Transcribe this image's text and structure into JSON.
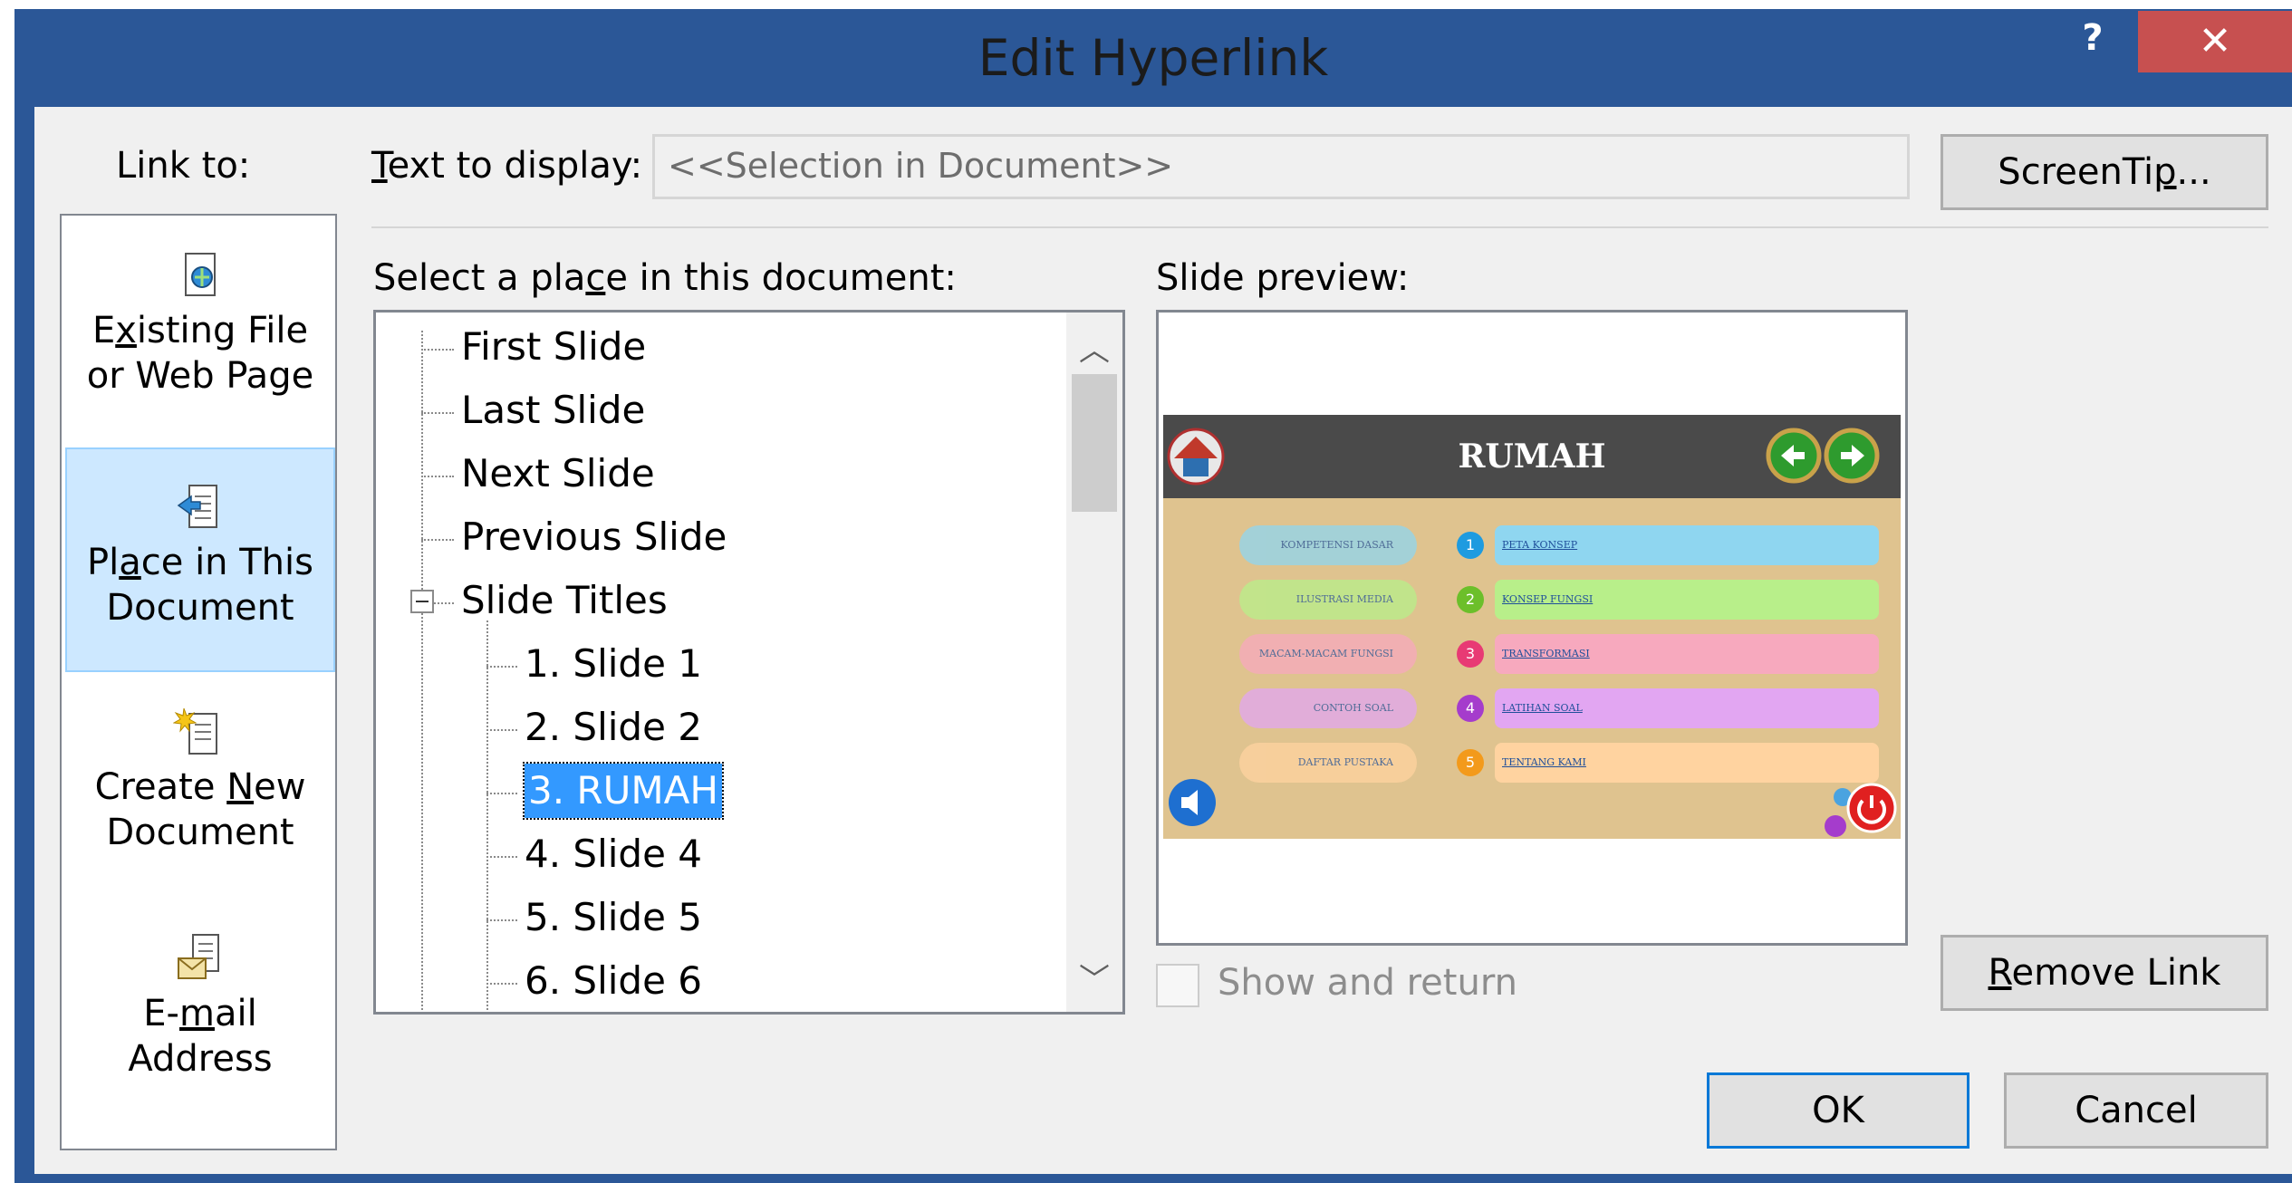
{
  "window": {
    "title": "Edit Hyperlink",
    "help_label": "?",
    "close_label": "✕"
  },
  "link_to": {
    "label": "Link to:",
    "items": [
      {
        "line1_pre": "E",
        "line1_u": "x",
        "line1_post": "isting File",
        "line2": "or Web Page",
        "icon": "existing-file-icon",
        "selected": false
      },
      {
        "line1_pre": "Pl",
        "line1_u": "a",
        "line1_post": "ce in This",
        "line2": "Document",
        "icon": "place-in-document-icon",
        "selected": true
      },
      {
        "line1_pre": "Create ",
        "line1_u": "N",
        "line1_post": "ew",
        "line2": "Document",
        "icon": "create-new-document-icon",
        "selected": false
      },
      {
        "line1_pre": "E-",
        "line1_u": "m",
        "line1_post": "ail",
        "line2": "Address",
        "icon": "email-address-icon",
        "selected": false
      }
    ]
  },
  "text_to_display": {
    "label_u": "T",
    "label_rest": "ext to display:",
    "value": "<<Selection in Document>>"
  },
  "buttons": {
    "screentip_pre": "ScreenTi",
    "screentip_u": "p",
    "screentip_post": "...",
    "remove_u": "R",
    "remove_rest": "emove Link",
    "ok": "OK",
    "cancel": "Cancel"
  },
  "place": {
    "label_pre": "Select a pla",
    "label_u": "c",
    "label_post": "e in this document:",
    "items": [
      "First Slide",
      "Last Slide",
      "Next Slide",
      "Previous Slide",
      "Slide Titles",
      "1. Slide 1",
      "2. Slide 2",
      "3. RUMAH",
      "4. Slide 4",
      "5. Slide 5",
      "6. Slide 6"
    ],
    "selected_index": 7
  },
  "preview": {
    "label": "Slide preview:",
    "slide_title": "RUMAH",
    "rows": [
      {
        "left": "KOMPETENSI DASAR",
        "num": "1",
        "right": "PETA KONSEP",
        "color": "#8fd6f0",
        "num_color": "#1e9be0"
      },
      {
        "left": "ILUSTRASI MEDIA",
        "num": "2",
        "right": "KONSEP FUNGSI",
        "color": "#b8ef8a",
        "num_color": "#6cbf2a"
      },
      {
        "left": "MACAM-MACAM FUNGSI",
        "num": "3",
        "right": "TRANSFORMASI",
        "color": "#f7a9be",
        "num_color": "#e83a74"
      },
      {
        "left": "CONTOH SOAL",
        "num": "4",
        "right": "LATIHAN SOAL",
        "color": "#e2a6f2",
        "num_color": "#a53ccc"
      },
      {
        "left": "DAFTAR PUSTAKA",
        "num": "5",
        "right": "TENTANG KAMI",
        "color": "#ffd3a0",
        "num_color": "#f39a1b"
      }
    ]
  },
  "show_and_return": {
    "label": "Show and return",
    "checked": false
  }
}
